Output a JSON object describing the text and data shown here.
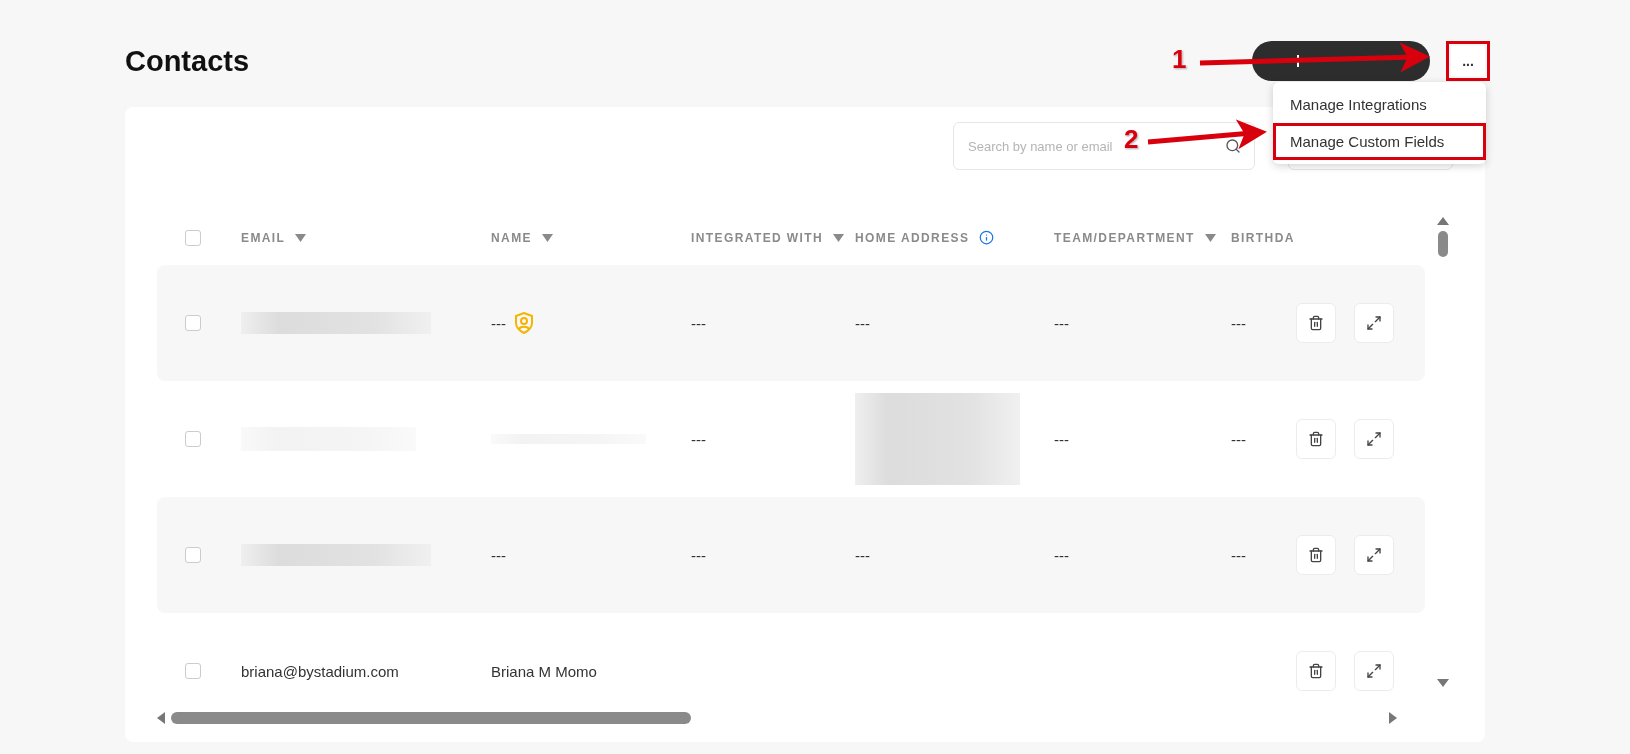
{
  "page": {
    "title": "Contacts"
  },
  "actions": {
    "more_button": {
      "label": "...",
      "highlighted": true
    }
  },
  "menu": {
    "items": [
      {
        "label": "Manage Integrations",
        "highlighted": false
      },
      {
        "label": "Manage Custom Fields",
        "highlighted": true
      }
    ]
  },
  "search": {
    "placeholder": "Search by name or email"
  },
  "table": {
    "select_all": {
      "checked": false
    },
    "columns": [
      {
        "label": "EMAIL",
        "kind": "sortable"
      },
      {
        "label": "NAME",
        "kind": "sortable"
      },
      {
        "label": "INTEGRATED WITH",
        "kind": "sortable"
      },
      {
        "label": "HOME ADDRESS",
        "kind": "info"
      },
      {
        "label": "TEAM/DEPARTMENT",
        "kind": "sortable"
      },
      {
        "label": "BIRTHDA",
        "kind": "plain"
      }
    ],
    "rows": [
      {
        "checked": false,
        "cells": [
          {
            "kind": "redacted"
          },
          {
            "kind": "text",
            "text": "---",
            "badge": true
          },
          {
            "kind": "text",
            "text": "---"
          },
          {
            "kind": "text",
            "text": "---"
          },
          {
            "kind": "text",
            "text": "---"
          },
          {
            "kind": "text",
            "text": "---"
          }
        ]
      },
      {
        "checked": false,
        "cells": [
          {
            "kind": "redacted"
          },
          {
            "kind": "redacted"
          },
          {
            "kind": "text",
            "text": "---"
          },
          {
            "kind": "redacted"
          },
          {
            "kind": "text",
            "text": "---"
          },
          {
            "kind": "text",
            "text": "---"
          }
        ]
      },
      {
        "checked": false,
        "cells": [
          {
            "kind": "redacted"
          },
          {
            "kind": "text",
            "text": "---"
          },
          {
            "kind": "text",
            "text": "---"
          },
          {
            "kind": "text",
            "text": "---"
          },
          {
            "kind": "text",
            "text": "---"
          },
          {
            "kind": "text",
            "text": "---"
          }
        ]
      },
      {
        "checked": false,
        "cells": [
          {
            "kind": "text",
            "text": "briana@bystadium.com"
          },
          {
            "kind": "text",
            "text": "Briana M Momo"
          },
          {
            "kind": "empty"
          },
          {
            "kind": "empty"
          },
          {
            "kind": "empty"
          },
          {
            "kind": "empty"
          }
        ]
      }
    ]
  },
  "annotations": [
    {
      "label": "1"
    },
    {
      "label": "2"
    }
  ]
}
